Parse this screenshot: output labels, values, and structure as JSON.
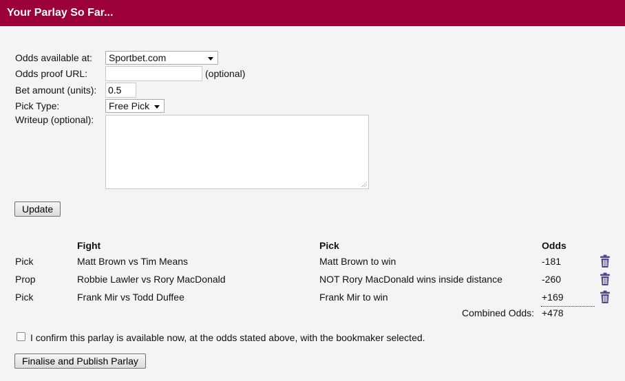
{
  "header": {
    "title": "Your Parlay So Far..."
  },
  "form": {
    "odds_available_label": "Odds available at:",
    "odds_available_value": "Sportbet.com",
    "odds_proof_label": "Odds proof URL:",
    "odds_proof_value": "",
    "odds_proof_hint": "(optional)",
    "bet_amount_label": "Bet amount (units):",
    "bet_amount_value": "0.5",
    "pick_type_label": "Pick Type:",
    "pick_type_value": "Free Pick",
    "writeup_label": "Writeup (optional):",
    "writeup_value": "",
    "update_label": "Update"
  },
  "table": {
    "headers": {
      "fight": "Fight",
      "pick": "Pick",
      "odds": "Odds"
    },
    "rows": [
      {
        "type": "Pick",
        "fight": "Matt Brown vs Tim Means",
        "pick": "Matt Brown to win",
        "odds": "-181"
      },
      {
        "type": "Prop",
        "fight": "Robbie Lawler vs Rory MacDonald",
        "pick": "NOT Rory MacDonald wins inside distance",
        "odds": "-260"
      },
      {
        "type": "Pick",
        "fight": "Frank Mir vs Todd Duffee",
        "pick": "Frank Mir to win",
        "odds": "+169"
      }
    ],
    "combined_label": "Combined Odds:",
    "combined_value": "+478"
  },
  "confirm": {
    "label": "I confirm this parlay is available now, at the odds stated above, with the bookmaker selected.",
    "checked": false
  },
  "publish_label": "Finalise and Publish Parlay",
  "icons": {
    "delete": "trash-icon"
  },
  "colors": {
    "header_bg": "#9b0038",
    "trash": "#4a4a8a"
  }
}
